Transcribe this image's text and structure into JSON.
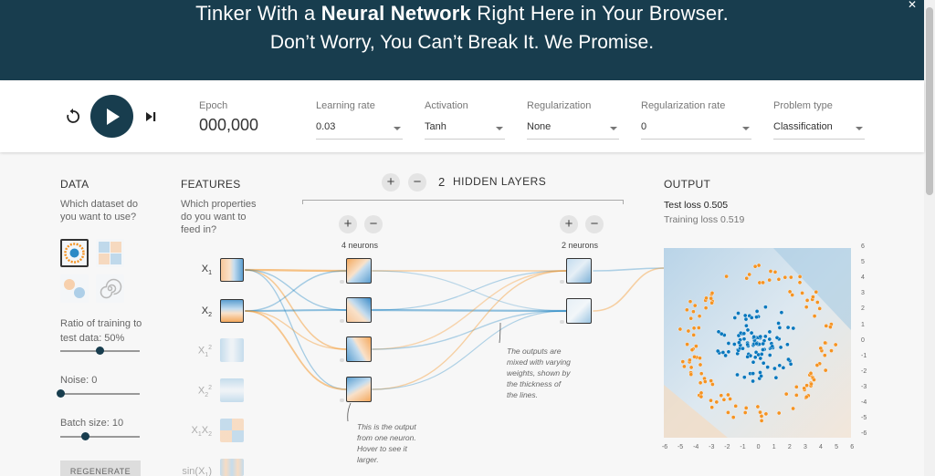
{
  "header": {
    "line1_pre": "Tinker With a ",
    "line1_bold": "Neural Network",
    "line1_post": " Right Here in Your Browser.",
    "line2": "Don’t Worry, You Can’t Break It. We Promise."
  },
  "controls": {
    "epoch_label": "Epoch",
    "epoch_value": "000,000",
    "learning_rate": {
      "label": "Learning rate",
      "value": "0.03"
    },
    "activation": {
      "label": "Activation",
      "value": "Tanh"
    },
    "regularization": {
      "label": "Regularization",
      "value": "None"
    },
    "regularization_rate": {
      "label": "Regularization rate",
      "value": "0"
    },
    "problem_type": {
      "label": "Problem type",
      "value": "Classification"
    }
  },
  "data_panel": {
    "title": "DATA",
    "desc1": "Which dataset do",
    "desc2": "you want to use?",
    "ratio_label1": "Ratio of training to",
    "ratio_label2": "test data:  50%",
    "ratio_value": 50,
    "noise_label": "Noise:  0",
    "noise_value": 0,
    "batch_label": "Batch size:  10",
    "batch_value": 10,
    "regenerate": "REGENERATE"
  },
  "features_panel": {
    "title": "FEATURES",
    "desc1": "Which properties",
    "desc2": "do you want to",
    "desc3": "feed in?",
    "features": [
      {
        "base": "X",
        "sub": "1",
        "sup": "",
        "active": true
      },
      {
        "base": "X",
        "sub": "2",
        "sup": "",
        "active": true
      },
      {
        "base": "X",
        "sub": "1",
        "sup": "2",
        "active": false
      },
      {
        "base": "X",
        "sub": "2",
        "sup": "2",
        "active": false
      },
      {
        "base": "X",
        "sub": "1",
        "sup": "",
        "base2": "X",
        "sub2": "2",
        "active": false
      },
      {
        "base": "sin(X",
        "sub": "1",
        "post": ")",
        "active": false
      }
    ]
  },
  "network": {
    "hidden_layers_count": "2",
    "hidden_layers_label": "HIDDEN LAYERS",
    "layer1_neurons": "4 neurons",
    "layer2_neurons": "2 neurons",
    "annotation_output": [
      "This is the output",
      "from one neuron.",
      "Hover to see it",
      "larger."
    ],
    "annotation_weights": [
      "The outputs are",
      "mixed with varying",
      "weights, shown by",
      "the thickness of",
      "the lines."
    ]
  },
  "output_panel": {
    "title": "OUTPUT",
    "test_loss": "Test loss 0.505",
    "training_loss": "Training loss 0.519",
    "y_ticks": [
      "6",
      "5",
      "4",
      "3",
      "2",
      "1",
      "0",
      "-1",
      "-2",
      "-3",
      "-4",
      "-5",
      "-6"
    ],
    "x_ticks": [
      "-6",
      "-5",
      "-4",
      "-3",
      "-2",
      "-1",
      "0",
      "1",
      "2",
      "3",
      "4",
      "5",
      "6"
    ]
  },
  "colors": {
    "header_bg": "#183d4e",
    "positive": "#0877bd",
    "negative": "#f59322"
  }
}
